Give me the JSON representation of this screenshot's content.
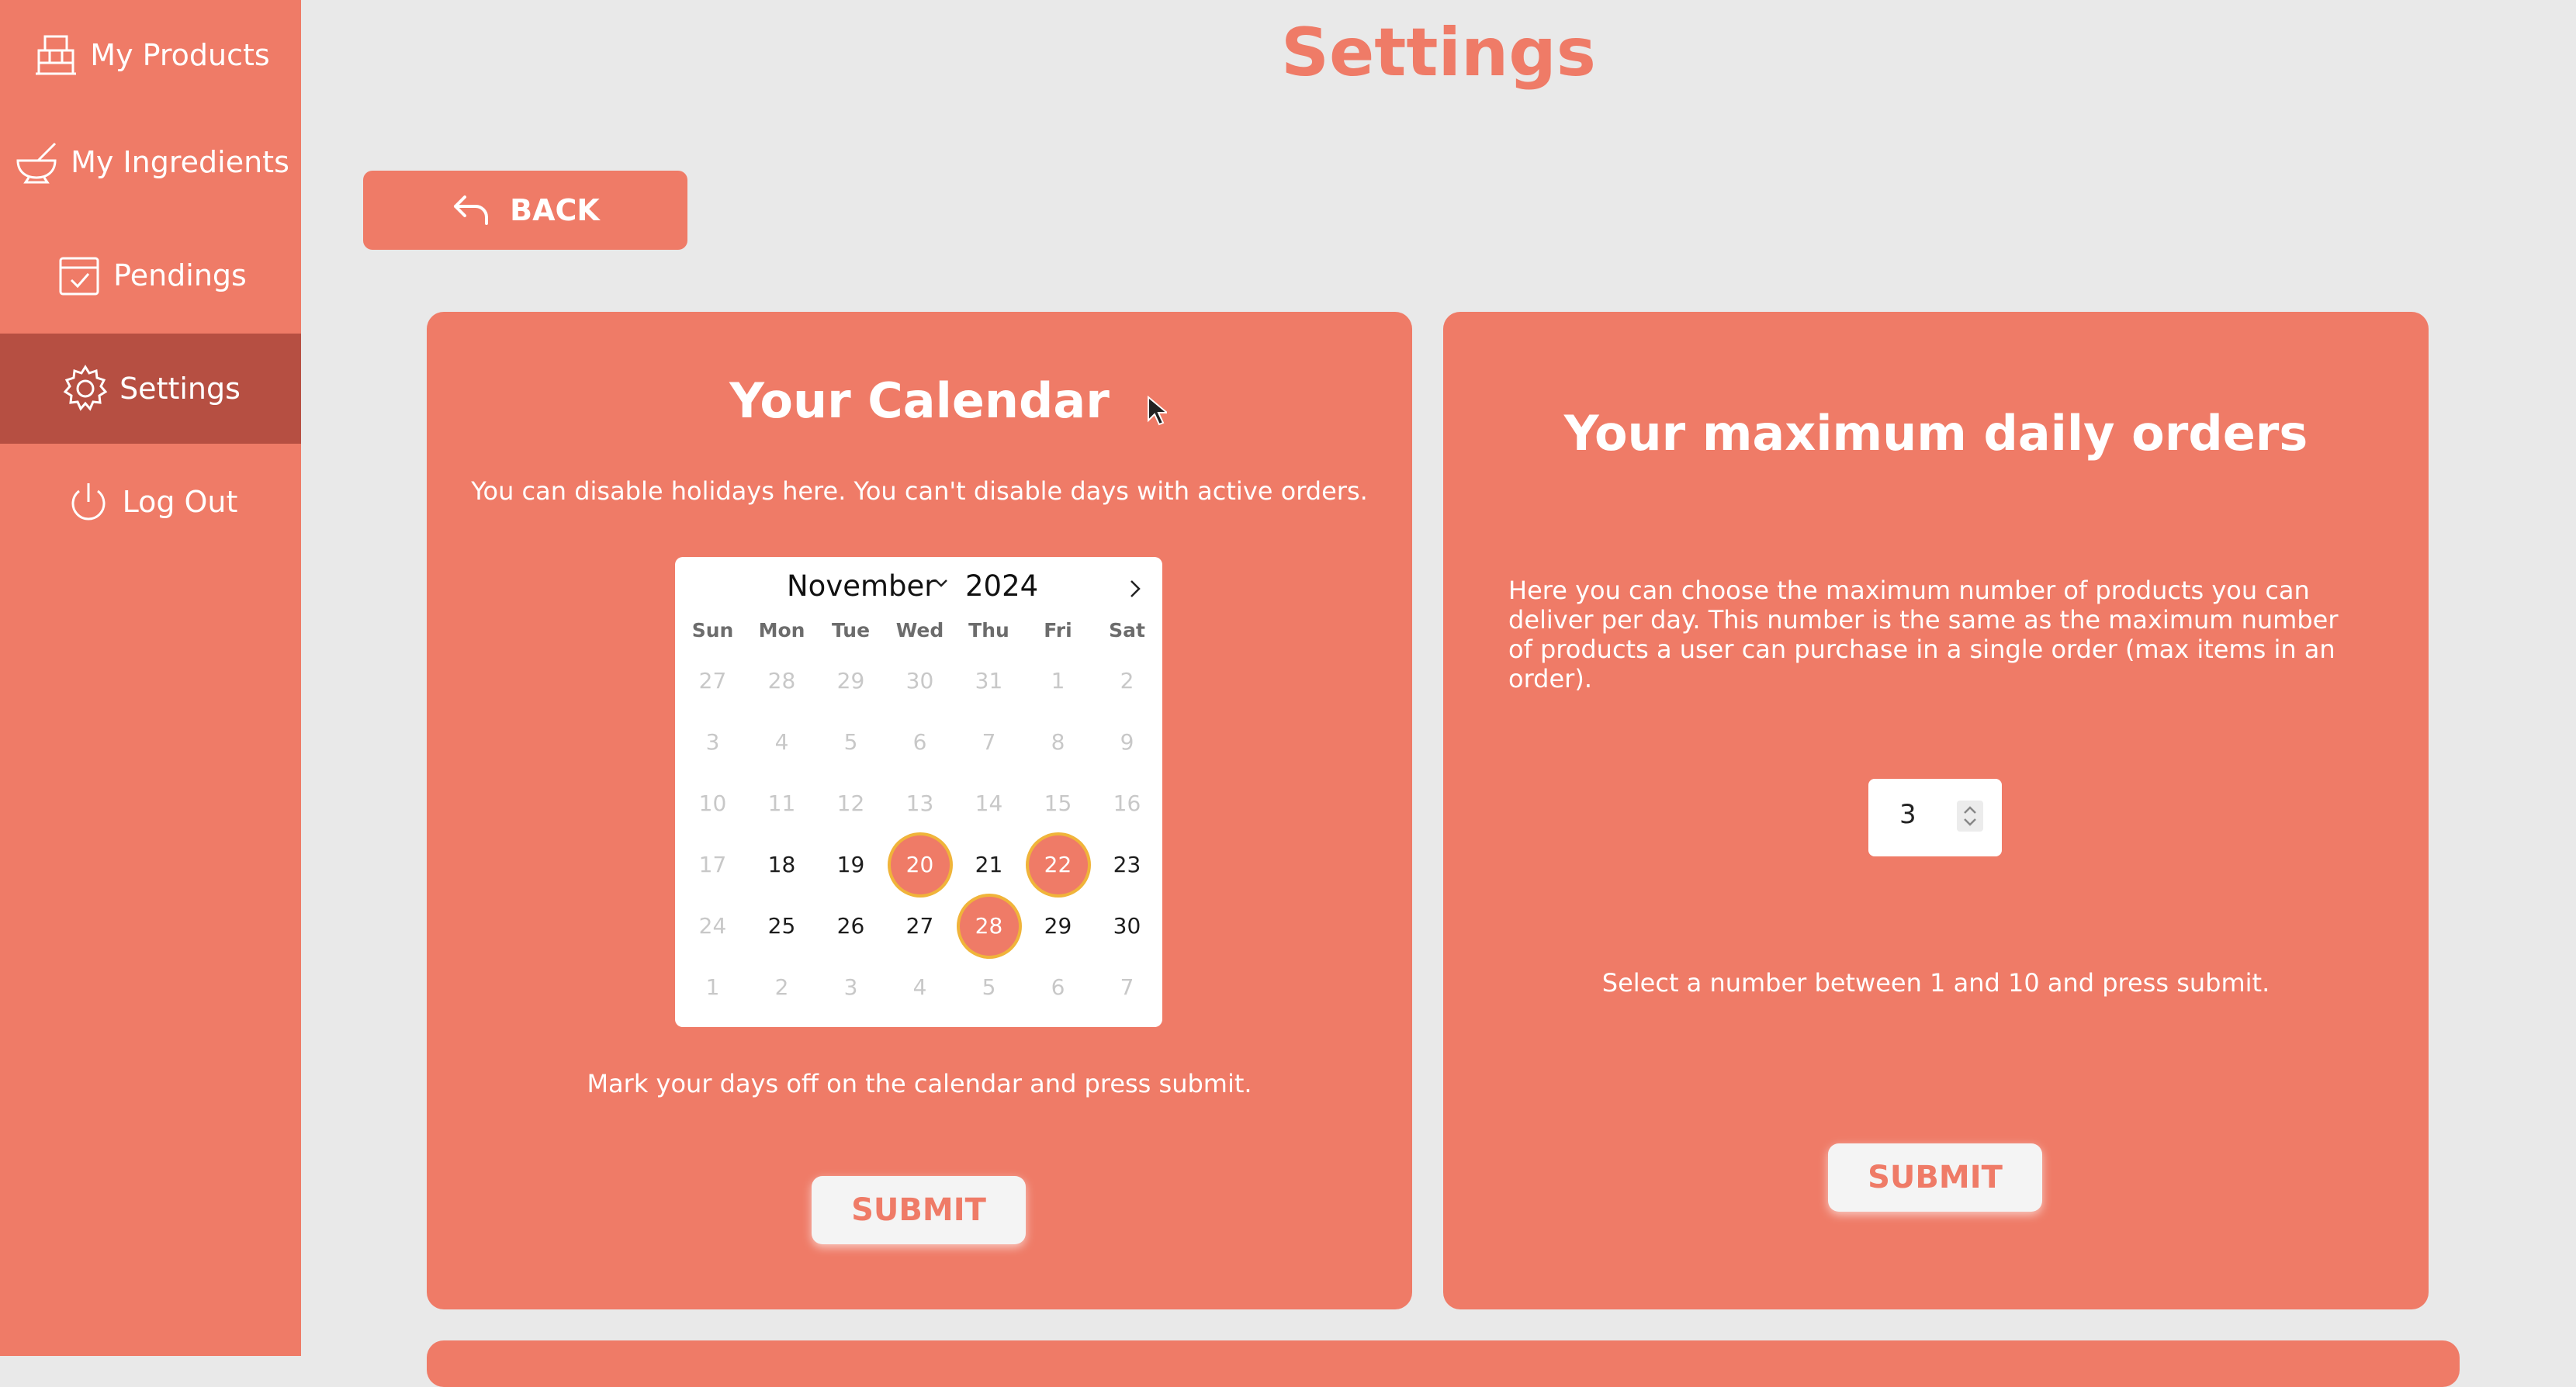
{
  "sidebar": {
    "items": [
      {
        "label": "My Products",
        "icon": "bakery-stand-icon"
      },
      {
        "label": "My Ingredients",
        "icon": "mortar-pestle-icon"
      },
      {
        "label": "Pendings",
        "icon": "calendar-check-icon"
      },
      {
        "label": "Settings",
        "icon": "gear-icon",
        "active": true
      },
      {
        "label": "Log Out",
        "icon": "power-icon"
      }
    ]
  },
  "header": {
    "title": "Settings"
  },
  "back_button": {
    "label": "BACK"
  },
  "calendar_panel": {
    "title": "Your Calendar",
    "description": "You can disable holidays here. You can't disable days with active orders.",
    "instruction": "Mark your days off on the calendar and press submit.",
    "submit_label": "SUBMIT",
    "calendar": {
      "month": "November",
      "year": "2024",
      "weekdays": [
        "Sun",
        "Mon",
        "Tue",
        "Wed",
        "Thu",
        "Fri",
        "Sat"
      ],
      "weeks": [
        [
          "27",
          "28",
          "29",
          "30",
          "31",
          "1",
          "2"
        ],
        [
          "3",
          "4",
          "5",
          "6",
          "7",
          "8",
          "9"
        ],
        [
          "10",
          "11",
          "12",
          "13",
          "14",
          "15",
          "16"
        ],
        [
          "17",
          "18",
          "19",
          "20",
          "21",
          "22",
          "23"
        ],
        [
          "24",
          "25",
          "26",
          "27",
          "28",
          "29",
          "30"
        ],
        [
          "1",
          "2",
          "3",
          "4",
          "5",
          "6",
          "7"
        ]
      ],
      "selected_days": [
        "20",
        "22",
        "28"
      ]
    }
  },
  "orders_panel": {
    "title": "Your maximum daily orders",
    "description": "Here you can choose the maximum number of products you can deliver per day. This number is the same as the maximum number of products a user can purchase in a single order (max items in an order).",
    "value": "3",
    "instruction": "Select a number between 1 and 10 and press submit.",
    "submit_label": "SUBMIT"
  },
  "colors": {
    "accent": "#ef7b67",
    "active_nav": "#b64f42",
    "background": "#e9e9e9",
    "selected_ring": "#f0b43a"
  }
}
